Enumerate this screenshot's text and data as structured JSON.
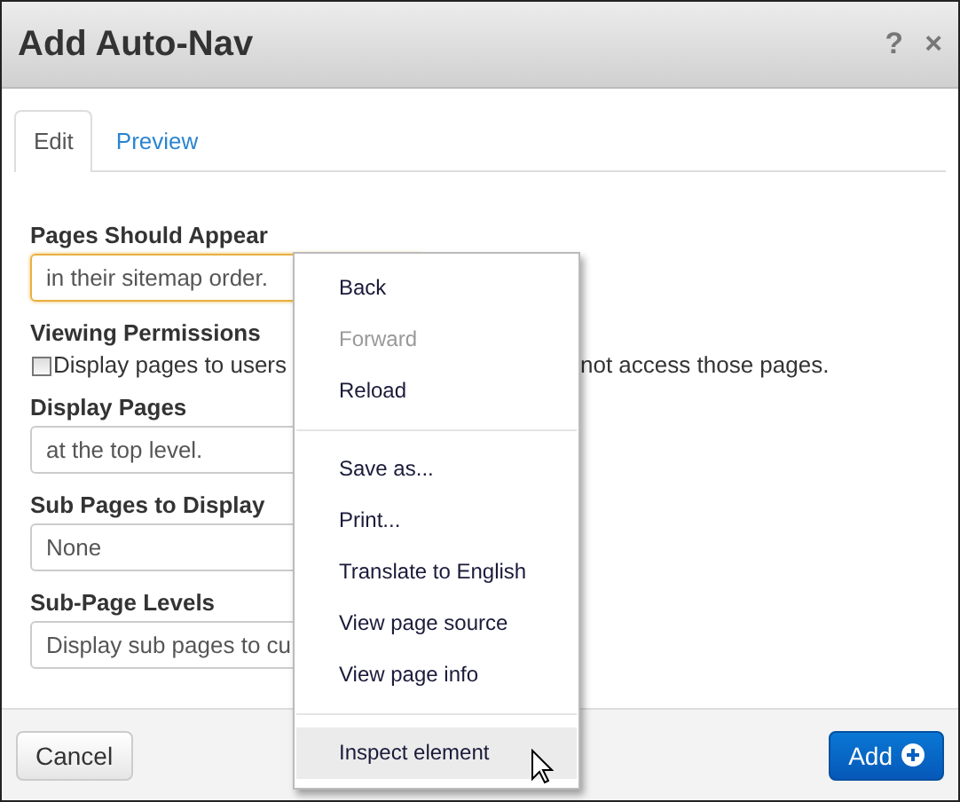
{
  "dialog": {
    "title": "Add Auto-Nav",
    "help": "?",
    "close": "×"
  },
  "tabs": [
    {
      "label": "Edit",
      "selected": true
    },
    {
      "label": "Preview",
      "selected": false
    }
  ],
  "fields": [
    {
      "kind": "select",
      "label": "Pages Should Appear",
      "value": "in their sitemap order.",
      "focused": true
    },
    {
      "kind": "checkbox",
      "label": "Viewing Permissions",
      "text_before": "Display pages to users",
      "text_after": "not access those pages.",
      "checked": false
    },
    {
      "kind": "select",
      "label": "Display Pages",
      "value": "at the top level.",
      "focused": false
    },
    {
      "kind": "select",
      "label": "Sub Pages to Display",
      "value": "None",
      "focused": false
    },
    {
      "kind": "select",
      "label": "Sub-Page Levels",
      "value": "Display sub pages to cu",
      "focused": false
    }
  ],
  "footer": {
    "cancel": "Cancel",
    "add": "Add"
  },
  "context_menu": {
    "items": [
      {
        "kind": "item",
        "label": "Back",
        "disabled": false,
        "highlighted": false
      },
      {
        "kind": "item",
        "label": "Forward",
        "disabled": true,
        "highlighted": false
      },
      {
        "kind": "item",
        "label": "Reload",
        "disabled": false,
        "highlighted": false
      },
      {
        "kind": "separator"
      },
      {
        "kind": "item",
        "label": "Save as...",
        "disabled": false,
        "highlighted": false
      },
      {
        "kind": "item",
        "label": "Print...",
        "disabled": false,
        "highlighted": false
      },
      {
        "kind": "item",
        "label": "Translate to English",
        "disabled": false,
        "highlighted": false
      },
      {
        "kind": "item",
        "label": "View page source",
        "disabled": false,
        "highlighted": false
      },
      {
        "kind": "item",
        "label": "View page info",
        "disabled": false,
        "highlighted": false
      },
      {
        "kind": "separator"
      },
      {
        "kind": "item",
        "label": "Inspect element",
        "disabled": false,
        "highlighted": true
      }
    ]
  }
}
